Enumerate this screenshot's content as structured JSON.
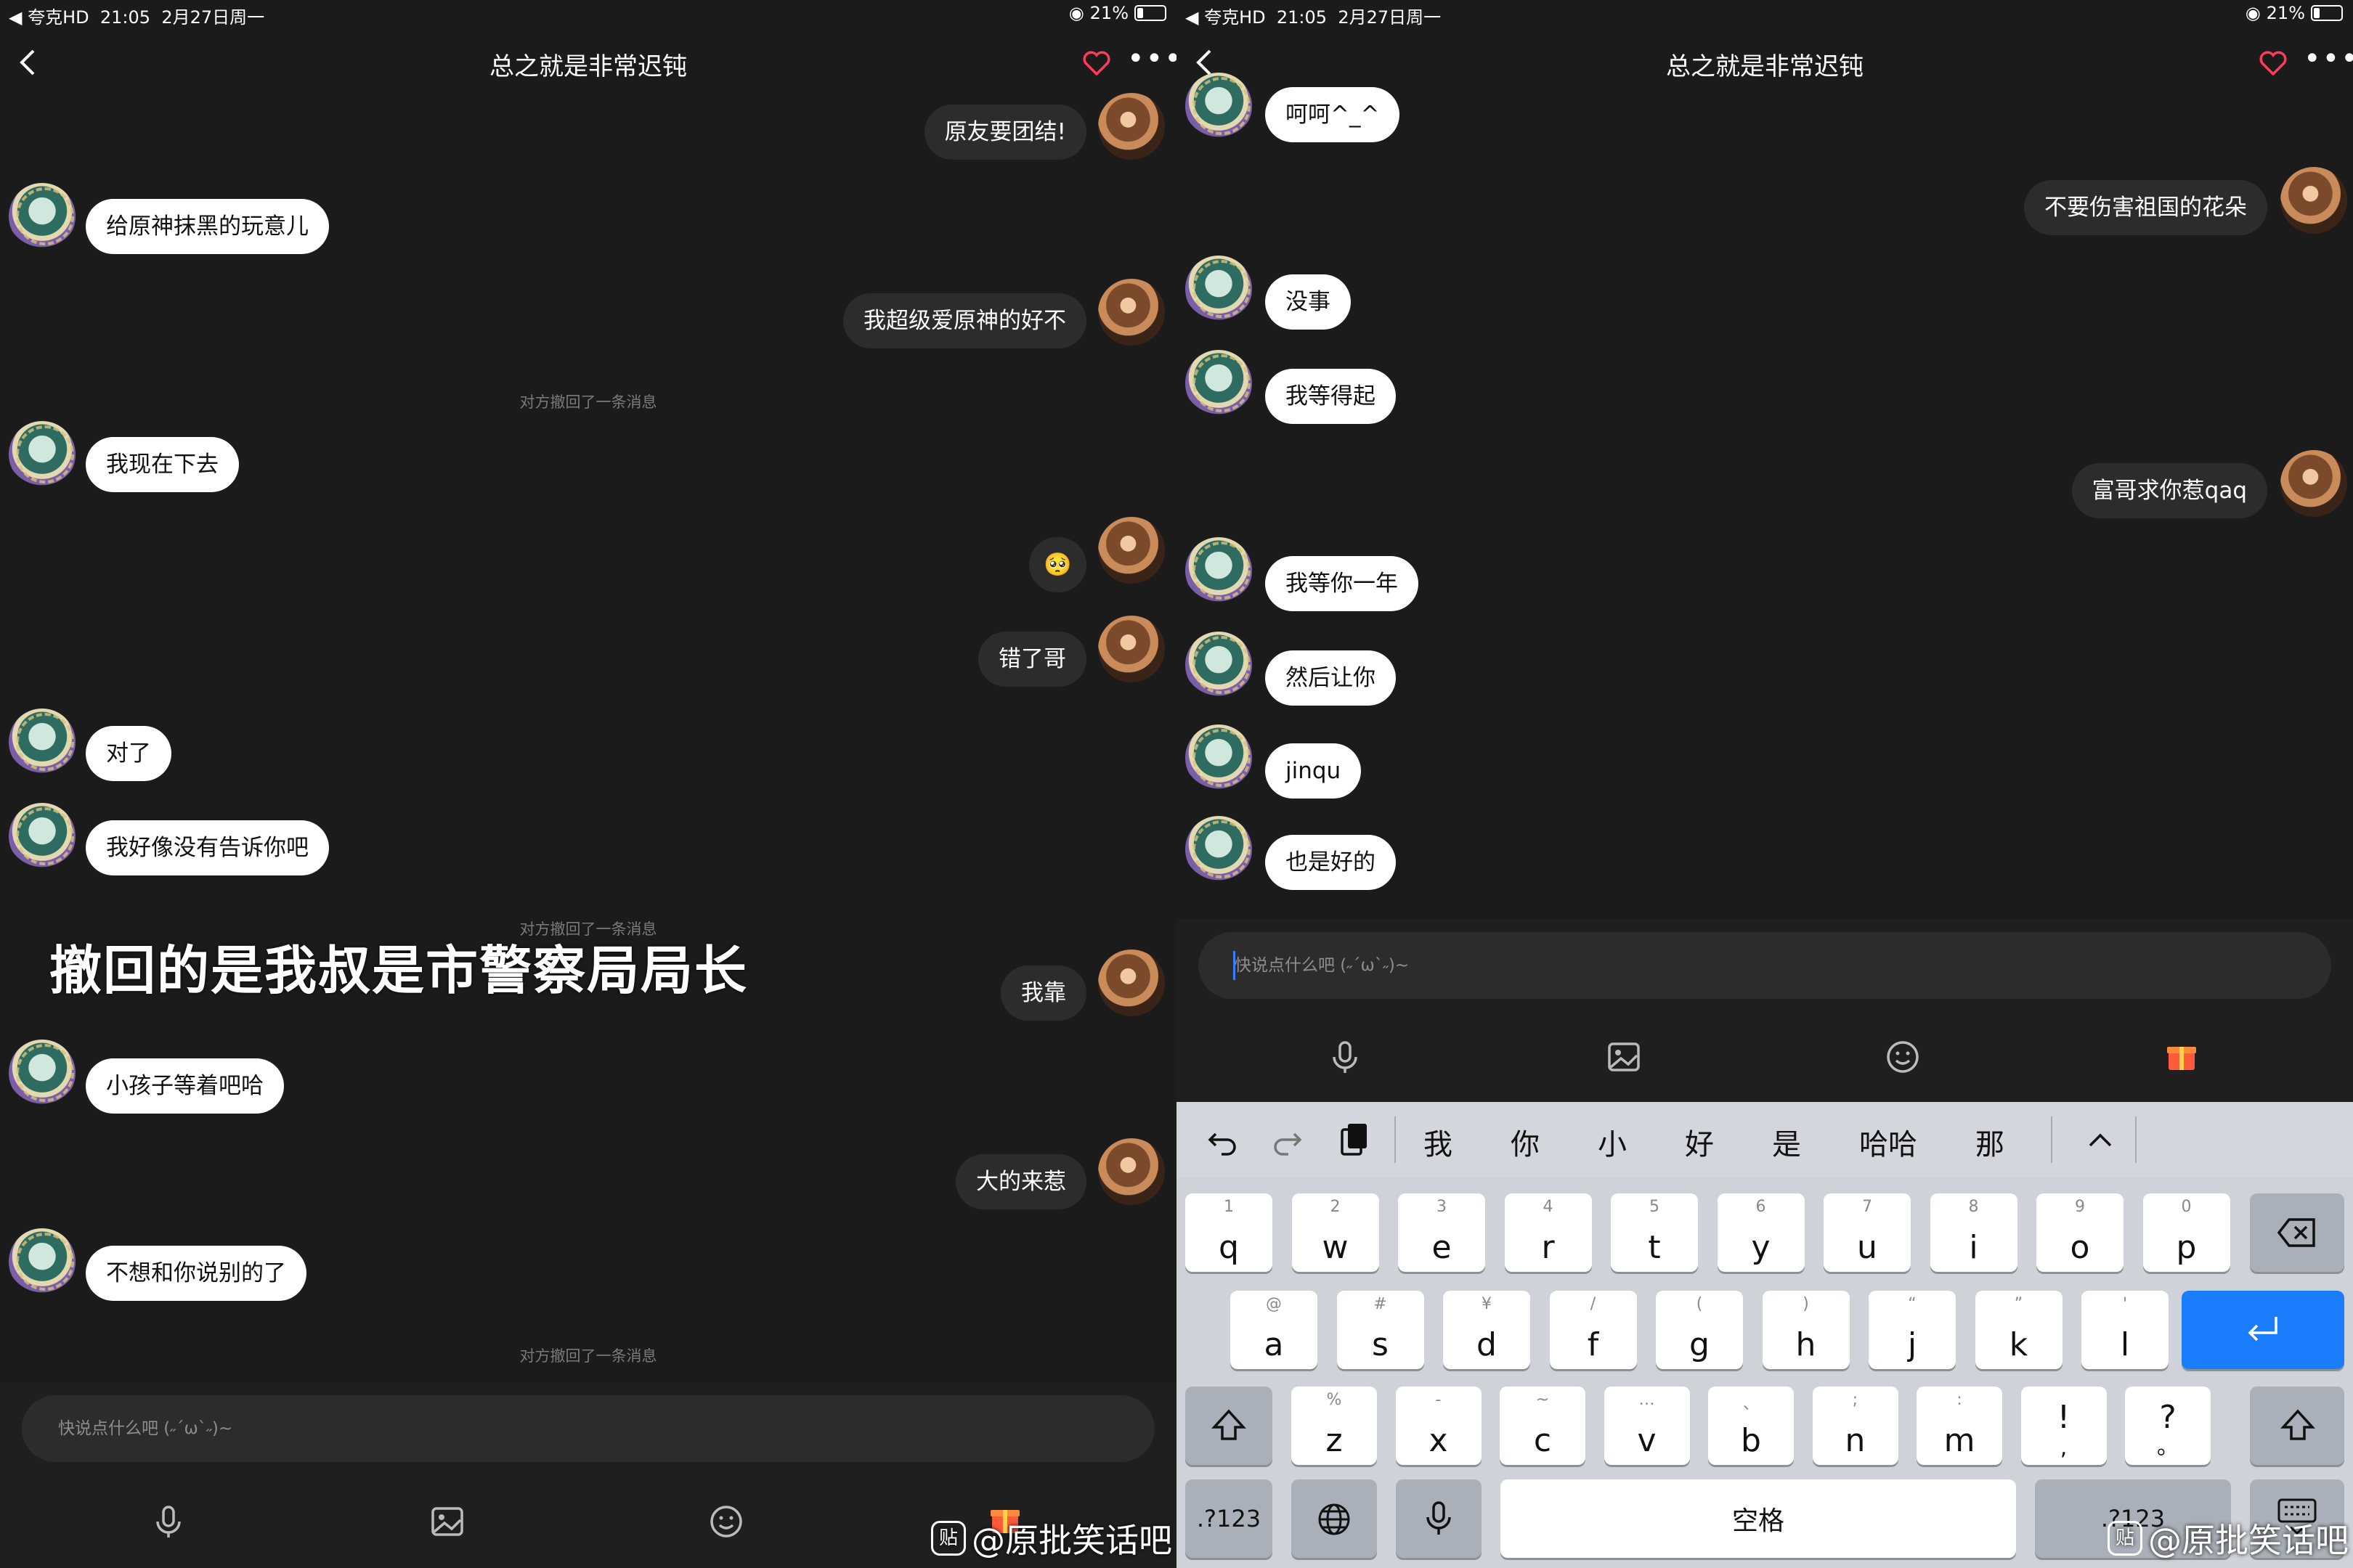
{
  "status": {
    "carrier": "◀ 夸克HD",
    "time": "21:05",
    "date": "2月27日周一",
    "battery": "21%"
  },
  "header": {
    "title": "总之就是非常迟钝"
  },
  "left": {
    "messages": [
      {
        "side": "self",
        "text": "原友要团结!"
      },
      {
        "side": "other",
        "text": "给原神抹黑的玩意儿"
      },
      {
        "side": "self",
        "text": "我超级爱原神的好不"
      },
      {
        "side": "notice",
        "text": "对方撤回了一条消息"
      },
      {
        "side": "other",
        "text": "我现在下去"
      },
      {
        "side": "self",
        "text": "🥺"
      },
      {
        "side": "self",
        "text": "错了哥"
      },
      {
        "side": "other",
        "text": "对了"
      },
      {
        "side": "other",
        "text": "我好像没有告诉你吧"
      },
      {
        "side": "notice",
        "text": "对方撤回了一条消息"
      },
      {
        "side": "self",
        "text": "我靠"
      },
      {
        "side": "other",
        "text": "小孩子等着吧哈"
      },
      {
        "side": "self",
        "text": "大的来惹"
      },
      {
        "side": "other",
        "text": "不想和你说别的了"
      },
      {
        "side": "notice",
        "text": "对方撤回了一条消息"
      }
    ],
    "overlay_caption": "撤回的是我叔是市警察局局长",
    "input_placeholder": "快说点什么吧 (˶ˊωˋ˶)~"
  },
  "right": {
    "messages": [
      {
        "side": "other",
        "text": "呵呵^_^"
      },
      {
        "side": "self",
        "text": "不要伤害祖国的花朵"
      },
      {
        "side": "other",
        "text": "没事"
      },
      {
        "side": "other",
        "text": "我等得起"
      },
      {
        "side": "self",
        "text": "富哥求你惹qaq"
      },
      {
        "side": "other",
        "text": "我等你一年"
      },
      {
        "side": "other",
        "text": "然后让你"
      },
      {
        "side": "other",
        "text": "jinqu"
      },
      {
        "side": "other",
        "text": "也是好的"
      }
    ],
    "input_placeholder": "快说点什么吧 (˶ˊωˋ˶)~"
  },
  "toolbar": {
    "icons": [
      "microphone-icon",
      "image-icon",
      "emoji-icon",
      "gift-icon"
    ]
  },
  "keyboard": {
    "candidates": [
      "我",
      "你",
      "小",
      "好",
      "是",
      "哈哈",
      "那"
    ],
    "row1": [
      {
        "k": "q",
        "s": "1"
      },
      {
        "k": "w",
        "s": "2"
      },
      {
        "k": "e",
        "s": "3"
      },
      {
        "k": "r",
        "s": "4"
      },
      {
        "k": "t",
        "s": "5"
      },
      {
        "k": "y",
        "s": "6"
      },
      {
        "k": "u",
        "s": "7"
      },
      {
        "k": "i",
        "s": "8"
      },
      {
        "k": "o",
        "s": "9"
      },
      {
        "k": "p",
        "s": "0"
      }
    ],
    "row2": [
      {
        "k": "a",
        "s": "@"
      },
      {
        "k": "s",
        "s": "#"
      },
      {
        "k": "d",
        "s": "¥"
      },
      {
        "k": "f",
        "s": "/"
      },
      {
        "k": "g",
        "s": "("
      },
      {
        "k": "h",
        "s": ")"
      },
      {
        "k": "j",
        "s": "“"
      },
      {
        "k": "k",
        "s": "”"
      },
      {
        "k": "l",
        "s": "'"
      }
    ],
    "row3": [
      {
        "k": "z",
        "s": "%"
      },
      {
        "k": "x",
        "s": "-"
      },
      {
        "k": "c",
        "s": "~"
      },
      {
        "k": "v",
        "s": "…"
      },
      {
        "k": "b",
        "s": "、"
      },
      {
        "k": "n",
        "s": ";"
      },
      {
        "k": "m",
        "s": ":"
      },
      {
        "k": "!",
        "s": ""
      },
      {
        "k": "?",
        "s": ""
      }
    ],
    "row3_under": {
      "!": ",",
      "?": "。"
    },
    "numkey": ".?123",
    "space": "空格"
  },
  "watermark": "@原批笑话吧",
  "colors": {
    "accent": "#1a7dfb",
    "heart": "#ff3b5c",
    "gift": "#ff5a3c"
  }
}
